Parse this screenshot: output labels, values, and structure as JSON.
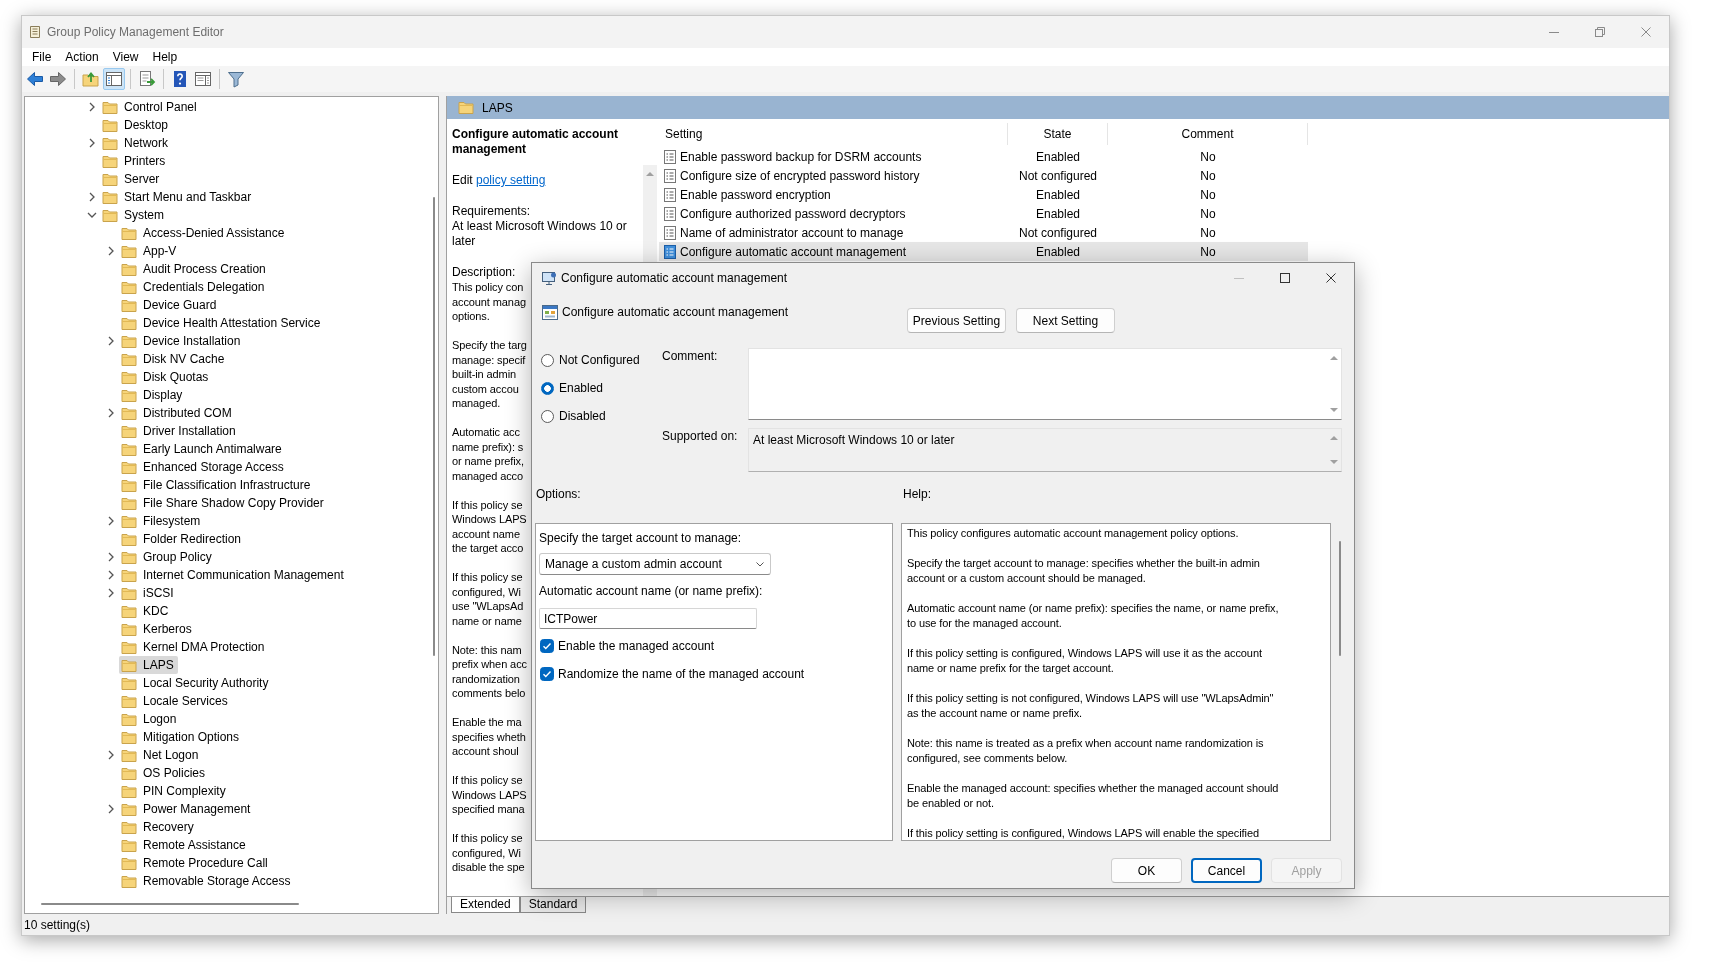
{
  "window": {
    "title": "Group Policy Management Editor"
  },
  "menu": [
    "File",
    "Action",
    "View",
    "Help"
  ],
  "toolbar": [
    [
      {
        "kind": "back",
        "pressed": false
      },
      {
        "kind": "forward",
        "pressed": false
      }
    ],
    [
      {
        "kind": "up",
        "pressed": false
      },
      {
        "kind": "tree-pane",
        "pressed": true
      }
    ],
    [
      {
        "kind": "export",
        "pressed": false
      }
    ],
    [
      {
        "kind": "help",
        "pressed": false
      },
      {
        "kind": "properties",
        "pressed": false
      }
    ],
    [
      {
        "kind": "filter",
        "pressed": false
      }
    ]
  ],
  "tree": [
    {
      "label": "Control Panel",
      "kind": "branch",
      "expanded": false,
      "selected": false
    },
    {
      "label": "Desktop",
      "kind": "leaf",
      "expanded": false,
      "selected": false
    },
    {
      "label": "Network",
      "kind": "branch",
      "expanded": false,
      "selected": false
    },
    {
      "label": "Printers",
      "kind": "leaf",
      "expanded": false,
      "selected": false
    },
    {
      "label": "Server",
      "kind": "leaf",
      "expanded": false,
      "selected": false
    },
    {
      "label": "Start Menu and Taskbar",
      "kind": "branch",
      "expanded": false,
      "selected": false
    },
    {
      "label": "System",
      "kind": "branch",
      "expanded": true,
      "selected": false,
      "children": [
        {
          "label": "Access-Denied Assistance",
          "kind": "leaf",
          "expanded": false,
          "selected": false
        },
        {
          "label": "App-V",
          "kind": "branch",
          "expanded": false,
          "selected": false
        },
        {
          "label": "Audit Process Creation",
          "kind": "leaf",
          "expanded": false,
          "selected": false
        },
        {
          "label": "Credentials Delegation",
          "kind": "leaf",
          "expanded": false,
          "selected": false
        },
        {
          "label": "Device Guard",
          "kind": "leaf",
          "expanded": false,
          "selected": false
        },
        {
          "label": "Device Health Attestation Service",
          "kind": "leaf",
          "expanded": false,
          "selected": false
        },
        {
          "label": "Device Installation",
          "kind": "branch",
          "expanded": false,
          "selected": false
        },
        {
          "label": "Disk NV Cache",
          "kind": "leaf",
          "expanded": false,
          "selected": false
        },
        {
          "label": "Disk Quotas",
          "kind": "leaf",
          "expanded": false,
          "selected": false
        },
        {
          "label": "Display",
          "kind": "leaf",
          "expanded": false,
          "selected": false
        },
        {
          "label": "Distributed COM",
          "kind": "branch",
          "expanded": false,
          "selected": false
        },
        {
          "label": "Driver Installation",
          "kind": "leaf",
          "expanded": false,
          "selected": false
        },
        {
          "label": "Early Launch Antimalware",
          "kind": "leaf",
          "expanded": false,
          "selected": false
        },
        {
          "label": "Enhanced Storage Access",
          "kind": "leaf",
          "expanded": false,
          "selected": false
        },
        {
          "label": "File Classification Infrastructure",
          "kind": "leaf",
          "expanded": false,
          "selected": false
        },
        {
          "label": "File Share Shadow Copy Provider",
          "kind": "leaf",
          "expanded": false,
          "selected": false
        },
        {
          "label": "Filesystem",
          "kind": "branch",
          "expanded": false,
          "selected": false
        },
        {
          "label": "Folder Redirection",
          "kind": "leaf",
          "expanded": false,
          "selected": false
        },
        {
          "label": "Group Policy",
          "kind": "branch",
          "expanded": false,
          "selected": false
        },
        {
          "label": "Internet Communication Management",
          "kind": "branch",
          "expanded": false,
          "selected": false
        },
        {
          "label": "iSCSI",
          "kind": "branch",
          "expanded": false,
          "selected": false
        },
        {
          "label": "KDC",
          "kind": "leaf",
          "expanded": false,
          "selected": false
        },
        {
          "label": "Kerberos",
          "kind": "leaf",
          "expanded": false,
          "selected": false
        },
        {
          "label": "Kernel DMA Protection",
          "kind": "leaf",
          "expanded": false,
          "selected": false
        },
        {
          "label": "LAPS",
          "kind": "leaf",
          "expanded": false,
          "selected": true
        },
        {
          "label": "Local Security Authority",
          "kind": "leaf",
          "expanded": false,
          "selected": false
        },
        {
          "label": "Locale Services",
          "kind": "leaf",
          "expanded": false,
          "selected": false
        },
        {
          "label": "Logon",
          "kind": "leaf",
          "expanded": false,
          "selected": false
        },
        {
          "label": "Mitigation Options",
          "kind": "leaf",
          "expanded": false,
          "selected": false
        },
        {
          "label": "Net Logon",
          "kind": "branch",
          "expanded": false,
          "selected": false
        },
        {
          "label": "OS Policies",
          "kind": "leaf",
          "expanded": false,
          "selected": false
        },
        {
          "label": "PIN Complexity",
          "kind": "leaf",
          "expanded": false,
          "selected": false
        },
        {
          "label": "Power Management",
          "kind": "branch",
          "expanded": false,
          "selected": false
        },
        {
          "label": "Recovery",
          "kind": "leaf",
          "expanded": false,
          "selected": false
        },
        {
          "label": "Remote Assistance",
          "kind": "leaf",
          "expanded": false,
          "selected": false
        },
        {
          "label": "Remote Procedure Call",
          "kind": "leaf",
          "expanded": false,
          "selected": false
        },
        {
          "label": "Removable Storage Access",
          "kind": "leaf",
          "expanded": false,
          "selected": false
        }
      ]
    }
  ],
  "details": {
    "header": "LAPS",
    "title": "Configure automatic account management",
    "edit_text": "Edit",
    "edit_link": "policy setting",
    "requirements_label": "Requirements:",
    "requirements": "At least Microsoft Windows 10 or later",
    "description_label": "Description:",
    "description": [
      [
        "This policy con",
        "account manag",
        "options."
      ],
      [
        "Specify the targ",
        "manage: specif",
        "built-in admin",
        "custom accou",
        "managed."
      ],
      [
        "Automatic acc",
        "name prefix): s",
        "or name prefix,",
        "managed acco"
      ],
      [
        "If this policy se",
        "Windows LAPS",
        "account name",
        "the target acco"
      ],
      [
        "If this policy se",
        "configured, Wi",
        "use \"WLapsAd",
        "name or name"
      ],
      [
        "Note: this nam",
        "prefix when acc",
        "randomization",
        "comments belo"
      ],
      [
        "Enable the ma",
        "specifies wheth",
        "account shoul"
      ],
      [
        "If this policy se",
        "Windows LAPS",
        "specified mana"
      ],
      [
        "If this policy se",
        "configured, Wi",
        "disable the spe"
      ]
    ]
  },
  "settings_table": {
    "columns": [
      "Setting",
      "State",
      "Comment"
    ],
    "rows": [
      {
        "setting": "Enable password backup for DSRM accounts",
        "state": "Enabled",
        "comment": "No",
        "selected": false
      },
      {
        "setting": "Configure size of encrypted password history",
        "state": "Not configured",
        "comment": "No",
        "selected": false
      },
      {
        "setting": "Enable password encryption",
        "state": "Enabled",
        "comment": "No",
        "selected": false
      },
      {
        "setting": "Configure authorized password decryptors",
        "state": "Enabled",
        "comment": "No",
        "selected": false
      },
      {
        "setting": "Name of administrator account to manage",
        "state": "Not configured",
        "comment": "No",
        "selected": false
      },
      {
        "setting": "Configure automatic account management",
        "state": "Enabled",
        "comment": "No",
        "selected": true
      }
    ]
  },
  "view_tabs": [
    {
      "label": "Extended",
      "selected": true
    },
    {
      "label": "Standard",
      "selected": false
    }
  ],
  "status_bar": "10 setting(s)",
  "dialog": {
    "title": "Configure automatic account management",
    "policy_name": "Configure automatic account management",
    "nav_buttons": [
      "Previous Setting",
      "Next Setting"
    ],
    "radios": [
      {
        "label": "Not Configured",
        "selected": false
      },
      {
        "label": "Enabled",
        "selected": true
      },
      {
        "label": "Disabled",
        "selected": false
      }
    ],
    "comment_label": "Comment:",
    "supported_label": "Supported on:",
    "supported": "At least Microsoft Windows 10 or later",
    "options_label": "Options:",
    "help_label": "Help:",
    "options": [
      {
        "kind": "label",
        "text": "Specify the target account to manage:"
      },
      {
        "kind": "dropdown",
        "value": "Manage a custom admin account"
      },
      {
        "kind": "label",
        "text": "Automatic account name (or name prefix):"
      },
      {
        "kind": "textbox",
        "value": "ICTPower"
      },
      {
        "kind": "checkbox",
        "label": "Enable the managed account",
        "checked": true
      },
      {
        "kind": "checkbox",
        "label": "Randomize the name of the managed account",
        "checked": true
      }
    ],
    "help": [
      [
        "This policy configures automatic account management policy options."
      ],
      [
        "Specify the target account to manage: specifies whether the built-in admin",
        "account or a custom account should be managed."
      ],
      [
        "Automatic account name (or name prefix): specifies the name, or name prefix,",
        "to use for the managed account."
      ],
      [
        "If this policy setting is configured, Windows LAPS will use it as the account",
        "name or name prefix for the target account."
      ],
      [
        "If this policy setting is not configured, Windows LAPS will use \"WLapsAdmin\"",
        "as the account name or name prefix."
      ],
      [
        "Note: this name is treated as a prefix when account name randomization is",
        "configured, see comments below."
      ],
      [
        "Enable the managed account: specifies whether the managed account should",
        "be enabled or not."
      ],
      [
        "If this policy setting is configured, Windows LAPS will enable the specified"
      ]
    ],
    "buttons": [
      {
        "label": "OK",
        "focused": false,
        "disabled": false
      },
      {
        "label": "Cancel",
        "focused": true,
        "disabled": false
      },
      {
        "label": "Apply",
        "focused": false,
        "disabled": true
      }
    ]
  }
}
